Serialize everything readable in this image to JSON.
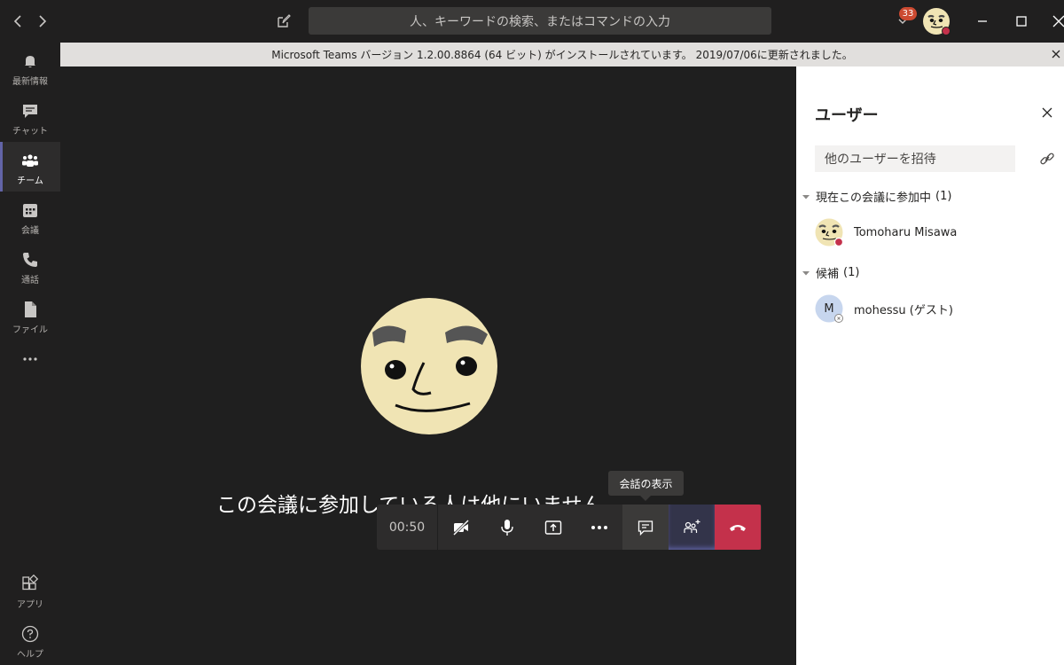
{
  "search": {
    "placeholder": "人、キーワードの検索、またはコマンドの入力"
  },
  "header": {
    "notification_count": "33"
  },
  "rail": {
    "items": [
      {
        "label": "最新情報",
        "icon": "bell-icon"
      },
      {
        "label": "チャット",
        "icon": "chat-icon"
      },
      {
        "label": "チーム",
        "icon": "teams-icon",
        "active": true
      },
      {
        "label": "会議",
        "icon": "calendar-icon"
      },
      {
        "label": "通話",
        "icon": "phone-icon"
      },
      {
        "label": "ファイル",
        "icon": "file-icon"
      }
    ],
    "bottom": [
      {
        "label": "アプリ",
        "icon": "apps-icon"
      },
      {
        "label": "ヘルプ",
        "icon": "help-icon"
      }
    ]
  },
  "infobar": {
    "text": "Microsoft Teams バージョン 1.2.00.8864 (64 ビット) がインストールされています。 2019/07/06に更新されました。"
  },
  "stage": {
    "message": "この会議に参加している人は他にいません。",
    "tooltip": "会話の表示"
  },
  "callbar": {
    "timer": "00:50"
  },
  "panel": {
    "title": "ユーザー",
    "invite_placeholder": "他のユーザーを招待",
    "in_meeting_label": "現在この会議に参加中",
    "in_meeting_count": "(1)",
    "suggested_label": "候補",
    "suggested_count": "(1)",
    "participants": [
      {
        "name": "Tomoharu Misawa"
      }
    ],
    "suggested": [
      {
        "name": "mohessu (ゲスト)",
        "initial": "M"
      }
    ]
  },
  "colors": {
    "accent": "#6264a7",
    "hangup": "#c4314b",
    "badge": "#cc4a31",
    "busy": "#c4314b"
  }
}
